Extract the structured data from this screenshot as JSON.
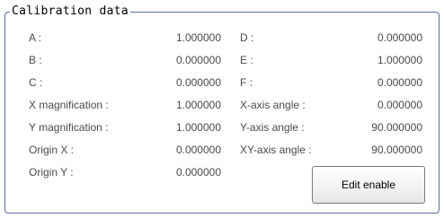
{
  "group_title": "Calibration data",
  "rows_left": [
    {
      "label": "A :",
      "value": "1.000000"
    },
    {
      "label": "B :",
      "value": "0.000000"
    },
    {
      "label": "C :",
      "value": "0.000000"
    },
    {
      "label": "X magnification :",
      "value": "1.000000"
    },
    {
      "label": "Y magnification :",
      "value": "1.000000"
    },
    {
      "label": "Origin X :",
      "value": "0.000000"
    },
    {
      "label": "Origin Y :",
      "value": "0.000000"
    }
  ],
  "rows_right": [
    {
      "label": "D :",
      "value": "0.000000"
    },
    {
      "label": "E :",
      "value": "1.000000"
    },
    {
      "label": "F :",
      "value": "0.000000"
    },
    {
      "label": "X-axis angle :",
      "value": "0.000000"
    },
    {
      "label": "Y-axis angle :",
      "value": "90.000000"
    },
    {
      "label": "XY-axis angle :",
      "value": "90.000000"
    }
  ],
  "edit_button_label": "Edit enable"
}
